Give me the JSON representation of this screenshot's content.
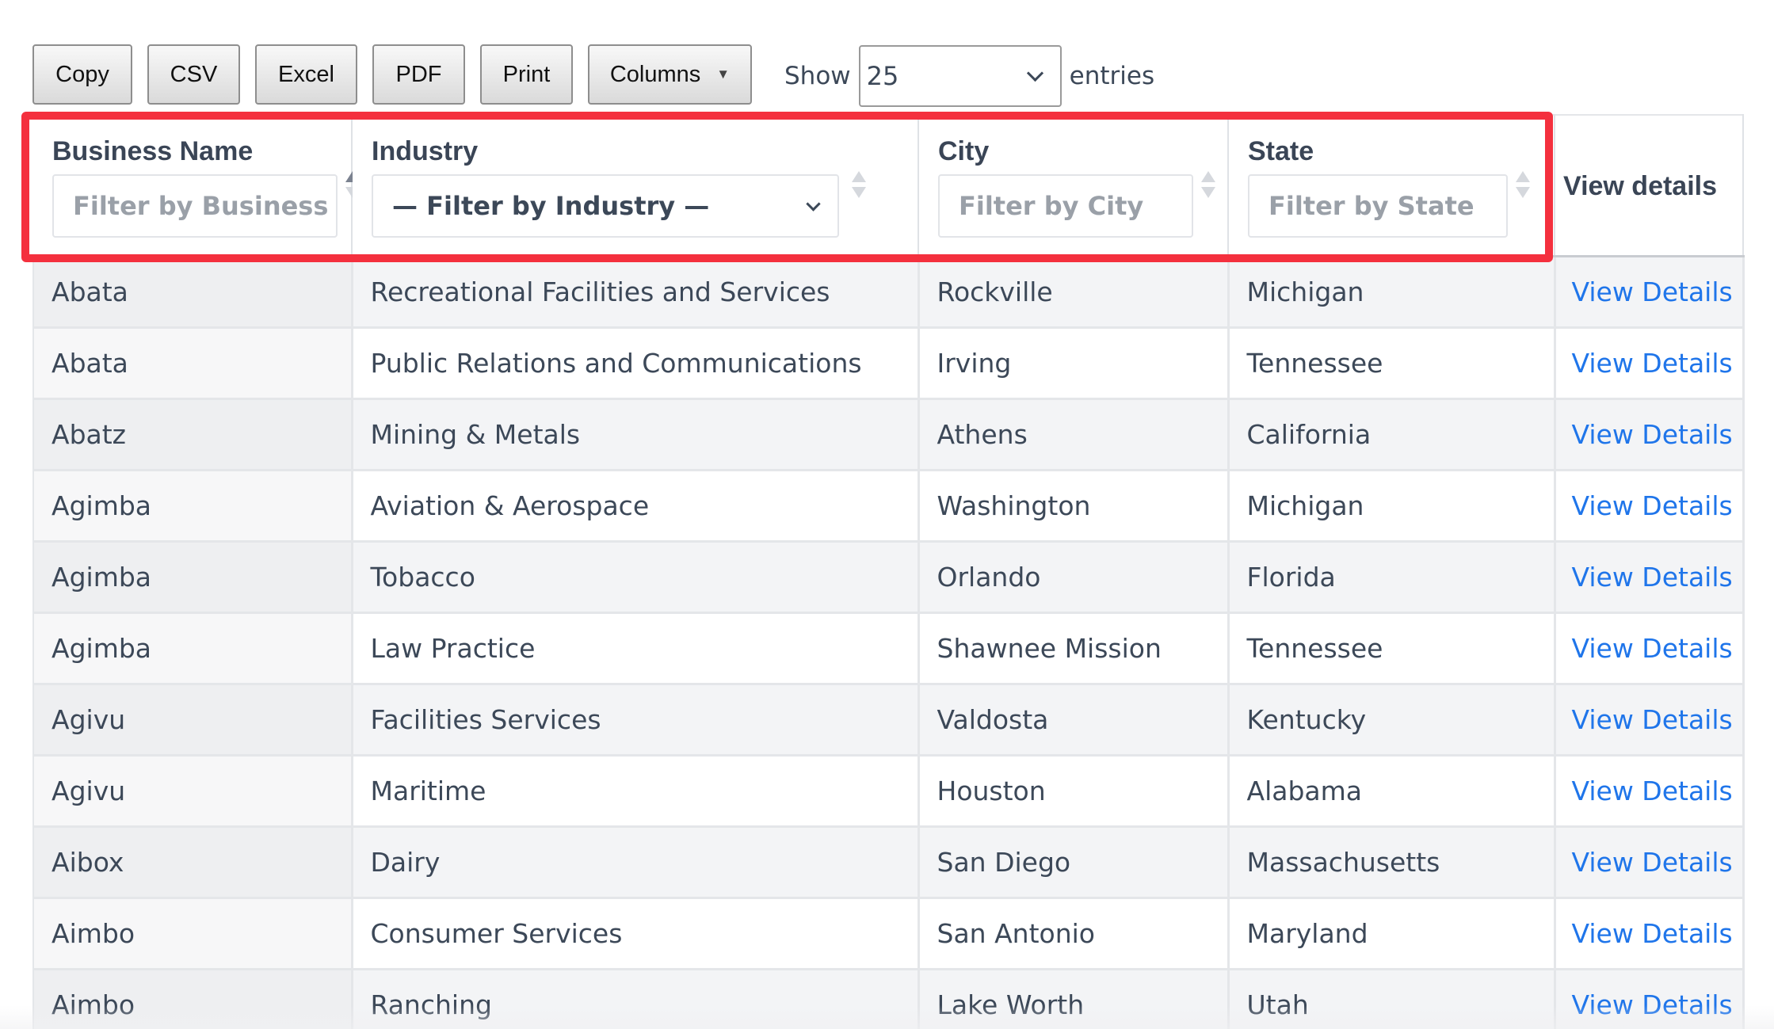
{
  "toolbar": {
    "buttons": [
      {
        "label": "Copy"
      },
      {
        "label": "CSV"
      },
      {
        "label": "Excel"
      },
      {
        "label": "PDF"
      },
      {
        "label": "Print"
      },
      {
        "label": "Columns"
      }
    ],
    "show_label": "Show",
    "entries_value": "25",
    "entries_label": "entries"
  },
  "columns": {
    "business": {
      "label": "Business Name",
      "placeholder": "Filter by Business"
    },
    "industry": {
      "label": "Industry",
      "selected": "— Filter by Industry —"
    },
    "city": {
      "label": "City",
      "placeholder": "Filter by City"
    },
    "state": {
      "label": "State",
      "placeholder": "Filter by State"
    },
    "view": {
      "label": "View details"
    }
  },
  "rows": [
    {
      "business": "Abata",
      "industry": "Recreational Facilities and Services",
      "city": "Rockville",
      "state": "Michigan",
      "action": "View Details"
    },
    {
      "business": "Abata",
      "industry": "Public Relations and Communications",
      "city": "Irving",
      "state": "Tennessee",
      "action": "View Details"
    },
    {
      "business": "Abatz",
      "industry": "Mining & Metals",
      "city": "Athens",
      "state": "California",
      "action": "View Details"
    },
    {
      "business": "Agimba",
      "industry": "Aviation & Aerospace",
      "city": "Washington",
      "state": "Michigan",
      "action": "View Details"
    },
    {
      "business": "Agimba",
      "industry": "Tobacco",
      "city": "Orlando",
      "state": "Florida",
      "action": "View Details"
    },
    {
      "business": "Agimba",
      "industry": "Law Practice",
      "city": "Shawnee Mission",
      "state": "Tennessee",
      "action": "View Details"
    },
    {
      "business": "Agivu",
      "industry": "Facilities Services",
      "city": "Valdosta",
      "state": "Kentucky",
      "action": "View Details"
    },
    {
      "business": "Agivu",
      "industry": "Maritime",
      "city": "Houston",
      "state": "Alabama",
      "action": "View Details"
    },
    {
      "business": "Aibox",
      "industry": "Dairy",
      "city": "San Diego",
      "state": "Massachusetts",
      "action": "View Details"
    },
    {
      "business": "Aimbo",
      "industry": "Consumer Services",
      "city": "San Antonio",
      "state": "Maryland",
      "action": "View Details"
    },
    {
      "business": "Aimbo",
      "industry": "Ranching",
      "city": "Lake Worth",
      "state": "Utah",
      "action": "View Details"
    }
  ],
  "colors": {
    "link": "#1f75ea",
    "highlight": "#f4303e",
    "text": "#3c4858"
  }
}
